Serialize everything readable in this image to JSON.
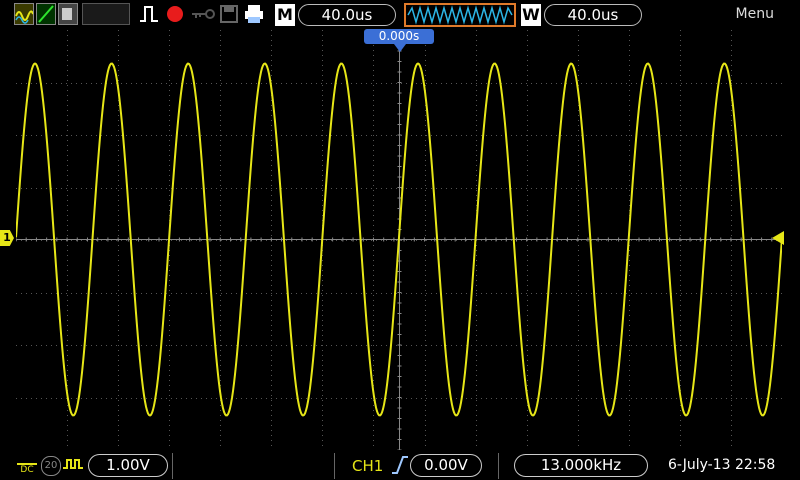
{
  "top_bar": {
    "run_state_icon": "record-dot-icon",
    "mode_letter": "M",
    "timebase": "40.0us",
    "window_letter": "W",
    "window_timebase": "40.0us",
    "menu_label": "Menu"
  },
  "screen": {
    "trigger_position": "0.000s",
    "ch1_marker": "1"
  },
  "bottom_bar": {
    "coupling": "DC",
    "bw_limit": "20",
    "ch1_scale": "1.00V",
    "trigger_source": "CH1",
    "trigger_level": "0.00V",
    "frequency": "13.000kHz",
    "datetime": "6-July-13 22:58"
  },
  "colors": {
    "ch1": "#e6e617",
    "trigger_marker": "#3b6fd6",
    "window_border": "#e07a2a",
    "window_wave": "#2cb6e6",
    "run_dot": "#e81c1c"
  }
}
